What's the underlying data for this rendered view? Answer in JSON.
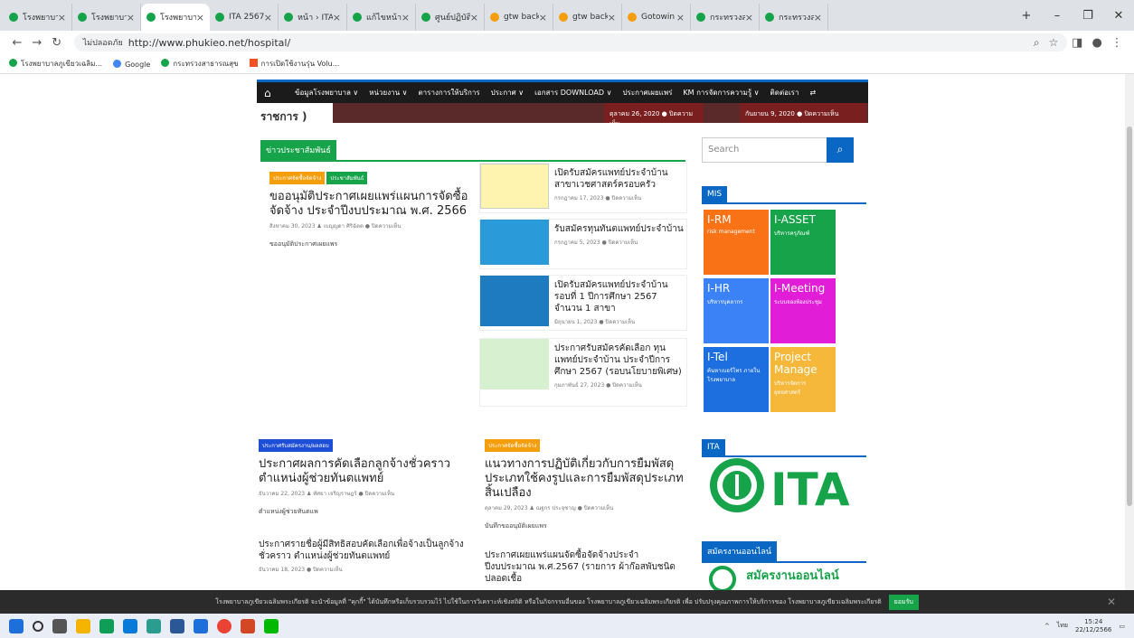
{
  "browser": {
    "tabs": [
      {
        "title": "โรงพยาบาลภูเขียว",
        "active": false
      },
      {
        "title": "โรงพยาบาลภูเขียว",
        "active": false
      },
      {
        "title": "โรงพยาบาลภูเขียว",
        "active": true
      },
      {
        "title": "ITA 2567 | IT",
        "active": false
      },
      {
        "title": "หน้า › ITA ใหม่",
        "active": false
      },
      {
        "title": "แก้ไขหน้า",
        "active": false
      },
      {
        "title": "ศูนย์ปฏิบัติการ",
        "active": false
      },
      {
        "title": "gtw backoffice",
        "active": false
      },
      {
        "title": "gtw backoffice",
        "active": false
      },
      {
        "title": "Gotowin",
        "active": false
      },
      {
        "title": "กระทรวงสาธารณ",
        "active": false
      },
      {
        "title": "กระทรวงสาธารณ",
        "active": false
      }
    ],
    "security_label": "ไม่ปลอดภัย",
    "url": "http://www.phukieo.net/hospital/",
    "bookmarks": [
      "โรงพยาบาลภูเขียวเฉลิม...",
      "Google",
      "กระทรวงสาธารณสุข",
      "การเปิดใช้งานรุ่น Volu..."
    ]
  },
  "site": {
    "nav": [
      "ข้อมูลโรงพยาบาล ∨",
      "หน่วยงาน ∨",
      "ตารางการให้บริการ",
      "ประกาศ ∨",
      "เอกสาร DOWNLOAD ∨",
      "ประกาศเผยแพร่",
      "KM การจัดการความรู้ ∨",
      "ติดต่อเรา"
    ],
    "slider_left_text": "ราชการ )",
    "slider_dates": [
      "ตุลาคม 26, 2020  ● ปิดความเห็น",
      "กันยายน 9, 2020  ● ปิดความเห็น"
    ],
    "section_title": "ข่าวประชาสัมพันธ์",
    "main_post": {
      "tags": [
        "ประกาศจัดซื้อจัดจ้าง",
        "ประชาสัมพันธ์"
      ],
      "title": "ขออนุมัติประกาศเผยแพร่แผนการจัดซื้อจัดจ้าง ประจำปีงบประมาณ พ.ศ. 2566",
      "meta": "สิงหาคม 30, 2023  ♟ เบญญดา ศิริฉัตต  ● ปิดความเห็น",
      "excerpt": "ขออนุมัติประกาศเผยแพร"
    },
    "small_posts": [
      {
        "title": "เปิดรับสมัครแพทย์ประจำบ้าน สาขาเวชศาสตร์ครอบครัว",
        "meta": "กรกฎาคม 17, 2023  ● ปิดความเห็น"
      },
      {
        "title": "รับสมัครทุนทันตแพทย์ประจำบ้าน",
        "meta": "กรกฎาคม 5, 2023  ● ปิดความเห็น"
      },
      {
        "title": "เปิดรับสมัครแพทย์ประจำบ้าน รอบที่ 1 ปีการศึกษา 2567 จำนวน 1 สาขา",
        "meta": "มิถุนายน 1, 2023  ● ปิดความเห็น"
      },
      {
        "title": "ประกาศรับสมัครคัดเลือก ทุนแพทย์ประจำบ้าน ประจำปีการศึกษา 2567 (รอบนโยบายพิเศษ)",
        "meta": "กุมภาพันธ์ 27, 2023  ● ปิดความเห็น"
      }
    ],
    "post2": {
      "tag": "ประกาศรับสมัครงาน/ผลสอบ",
      "title": "ประกาศผลการคัดเลือกลูกจ้างชั่วคราว ตำแหน่งผู้ช่วยทันตแพทย์",
      "meta": "ธันวาคม 22, 2023  ♟ ทัศยา เจริญราษฎร์  ● ปิดความเห็น",
      "excerpt": "ตำแหน่งผู้ช่วยทันตแพ"
    },
    "post3": {
      "tag": "ประกาศจัดซื้อจัดจ้าง",
      "title": "แนวทางการปฏิบัติเกี่ยวกับการยืมพัสดุ ประเภทใช้คงรูปและการยืมพัสดุประเภทสิ้นเปลือง",
      "meta": "ตุลาคม 29, 2023  ♟ ณฐกร ประจุชาญ  ● ปิดความเห็น",
      "excerpt": "บันทึกขออนุมัติเผยแพร"
    },
    "post4": {
      "title": "ประกาศรายชื่อผู้มีสิทธิสอบคัดเลือกเพื่อจ้างเป็นลูกจ้างชั่วคราว ตำแหน่งผู้ช่วยทันตแพทย์",
      "meta": "ธันวาคม 18, 2023  ● ปิดความเห็น"
    },
    "post5": {
      "title": "ประกาศเผยแพร่แผนจัดซื้อจัดจ้างประจำปีงบประมาณ พ.ศ.2567 (รายการ ผ้าก๊อสพับชนิดปลอดเชื้อ"
    },
    "search_placeholder": "Search",
    "mis_title": "MIS",
    "tiles": [
      {
        "a": "I-RM",
        "b": "risk management",
        "color": "#f97316"
      },
      {
        "a": "I-ASSET",
        "b": "บริหารครุภัณฑ์",
        "color": "#16a34a"
      },
      {
        "a": "I-HR",
        "b": "บริหารบุคลากร",
        "color": "#3b82f6"
      },
      {
        "a": "I-Meeting",
        "b": "ระบบจองห้องประชุม",
        "color": "#e11dd8"
      },
      {
        "a": "I-Tel",
        "b": "ค้นหาเบอร์โทร ภายในโรงพยาบาล",
        "color": "#1d6fe0"
      },
      {
        "a": "Project Manage",
        "b": "บริหารจัดการยุทธศาสตร์",
        "color": "#f5b83a"
      }
    ],
    "ita_title": "ITA",
    "ita_logo_text": "ITA",
    "apply_title": "สมัครงานออนไลน์",
    "apply_text": "สมัครงานออนไลน์"
  },
  "cookie": {
    "text": "โรงพยาบาลภูเขียวเฉลิมพระเกียรติ จะนำข้อมูลที่ \"คุกกี้\" ได้บันทึกหรือเก็บรวบรวมไว้ ไปใช้ในการวิเคราะห์เชิงสถิติ หรือในกิจกรรมอื่นของ โรงพยาบาลภูเขียวเฉลิมพระเกียรติ เพื่อ ปรับปรุงคุณภาพการให้บริการของ โรงพยาบาลภูเขียวเฉลิมพระเกียรติ",
    "accept": "ยอมรับ"
  },
  "taskbar": {
    "time": "15:24",
    "date": "22/12/2566",
    "lang": "ไทย"
  }
}
